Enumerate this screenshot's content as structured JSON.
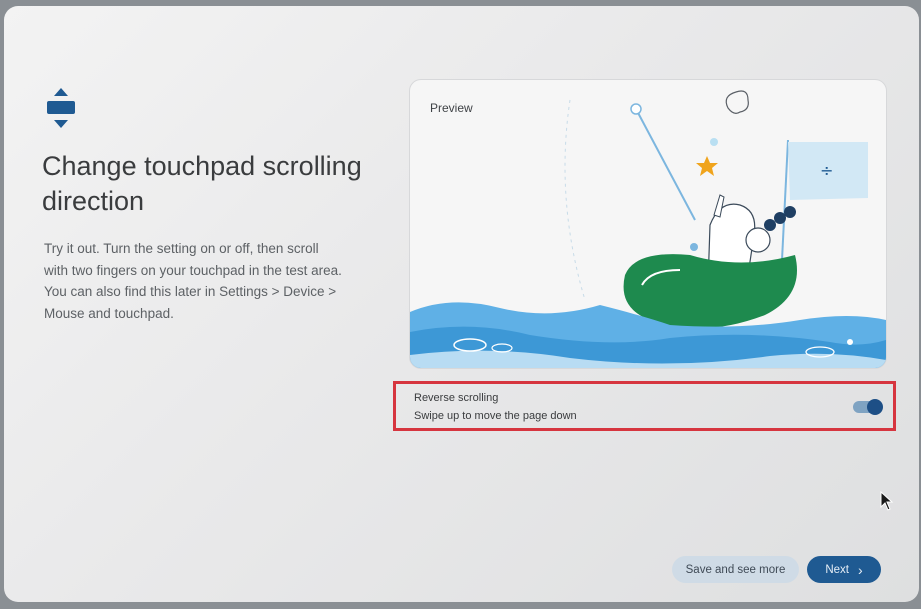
{
  "page": {
    "title": "Change touchpad scrolling direction",
    "description": "Try it out. Turn the setting on or off, then scroll with two fingers on your touchpad in the test area. You can also find this later in Settings > Device > Mouse and touchpad."
  },
  "preview": {
    "label": "Preview",
    "illustration": "person-fishing-in-green-boat-on-waves"
  },
  "setting": {
    "title": "Reverse scrolling",
    "subtitle": "Swipe up to move the page down",
    "toggle_on": true
  },
  "buttons": {
    "secondary_label": "Save and see more",
    "primary_label": "Next"
  },
  "icons": {
    "header": "scroll-direction-icon",
    "next": "chevron-right-icon",
    "cursor": "mouse-pointer-icon"
  },
  "colors": {
    "accent": "#1f5a92",
    "toggle_track": "#7fa3c2",
    "highlight_border": "#d6353f",
    "boat": "#1e8a4e",
    "water": "#5fb0e6"
  }
}
